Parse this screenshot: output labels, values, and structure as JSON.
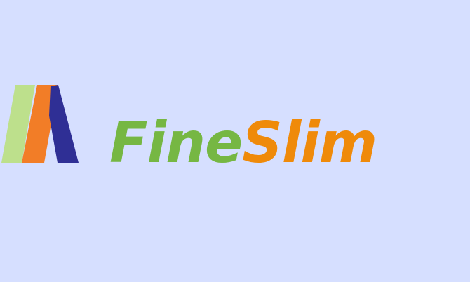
{
  "colors": {
    "background": "#d6dfff",
    "fine": "#76b743",
    "slim": "#ef8a0a",
    "mark_green": "#bde08c",
    "mark_orange": "#f27d27",
    "mark_blue": "#2f2f95"
  },
  "logo": {
    "word_first": "Fine",
    "word_second": "Slim"
  }
}
